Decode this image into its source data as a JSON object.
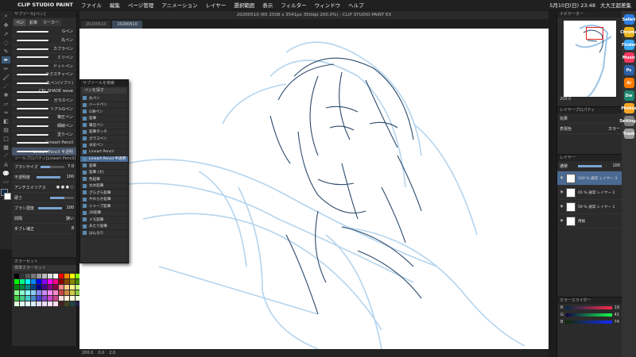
{
  "menubar": {
    "app_name": "CLIP STUDIO PAINT",
    "items": [
      "ファイル",
      "編集",
      "ページ管理",
      "アニメーション",
      "レイヤー",
      "選択範囲",
      "表示",
      "フィルター",
      "ウィンドウ",
      "ヘルプ"
    ],
    "clock": "5月10日(日) 23:48",
    "user": "大大王超差集"
  },
  "window": {
    "title": "20200510 (65 2508 x 3541px 350dpi 200.0%) - CLIP STUDIO PAINT EX",
    "tabs": [
      "20200510",
      "20200510"
    ]
  },
  "subtool_panel": {
    "header": "サブツール[ペン]",
    "tabs": [
      "ペン",
      "鉛筆",
      "マーカー"
    ],
    "brushes": [
      "Gペン",
      "丸ペン",
      "カブラペン",
      "ミリペン",
      "ドットペン",
      "テクスチャペン",
      "丸ペン(ソフト)",
      "CFL SHADE wave",
      "ガラスペン",
      "リアルGペン",
      "筆圧ペン",
      "細線ペン",
      "塗りペン",
      "Lineart Pencil",
      "Lineart Pencil 半透明"
    ],
    "selected_index": 14
  },
  "tool_property": {
    "header": "ツールプロパティ[Lineart Pencil]",
    "rows": [
      {
        "label": "ブラシサイズ",
        "value": "7.0"
      },
      {
        "label": "不透明度",
        "value": "100"
      },
      {
        "label": "アンチエイリアス",
        "value": ""
      },
      {
        "label": "硬さ",
        "value": ""
      },
      {
        "label": "ブラシ濃度",
        "value": "100"
      },
      {
        "label": "間隔",
        "value": "狭い"
      },
      {
        "label": "手ブレ補正",
        "value": "8"
      }
    ]
  },
  "color_panel": {
    "header": "カラーセット",
    "set_name": "標準カラーセット"
  },
  "dropdown": {
    "header": "サブツールを検索",
    "search": "ペンを探す",
    "items": [
      "丸ペン",
      "ハードペン",
      "G滑ペン",
      "鉛筆",
      "筆圧ペン",
      "鉛筆タッチ",
      "ガラスペン",
      "水彩ペン",
      "Lineart Pencil",
      "Lineart Pencil 半透明",
      "鉛筆",
      "鉛筆 (大)",
      "色鉛筆",
      "太め鉛筆",
      "ざらざら鉛筆",
      "やわらか鉛筆",
      "シャープ鉛筆",
      "2B鉛筆",
      "メモ鉛筆",
      "あたり鉛筆",
      "はんなり"
    ],
    "selected_index": 9
  },
  "status": {
    "zoom": "200.0",
    "angle": "0.0",
    "pos": "2.0"
  },
  "right_panel": {
    "navigator_header": "ナビゲーター",
    "zoom": "200.0",
    "angle": "0.0",
    "layerprop_header": "レイヤープロパティ",
    "effect_label": "効果",
    "color_label": "表現色",
    "color_value": "カラー",
    "layers_header": "レイヤー",
    "blend": "通常",
    "opacity": "100",
    "layers": [
      {
        "name": "100 % 通常 レイヤー 3"
      },
      {
        "name": "65 % 通常 レイヤー 2"
      },
      {
        "name": "59 % 通常 レイヤー 1"
      },
      {
        "name": "用紙"
      }
    ],
    "selected_layer": 0,
    "colorslider_header": "カラースライダー",
    "rgb": {
      "r": "19",
      "g": "41",
      "b": "74"
    }
  },
  "colors": {
    "accent": "#4a6a92",
    "main_color": "#142a4a",
    "sub_color": "#ffffff",
    "sketch_dark": "#2c4a6b",
    "sketch_light": "#9cc6e8"
  },
  "dock_apps": [
    "Safari",
    "Chrome",
    "Finder",
    "Music",
    "Ps",
    "Ai",
    "Dw",
    "Photos",
    "Settings",
    "Trash"
  ]
}
